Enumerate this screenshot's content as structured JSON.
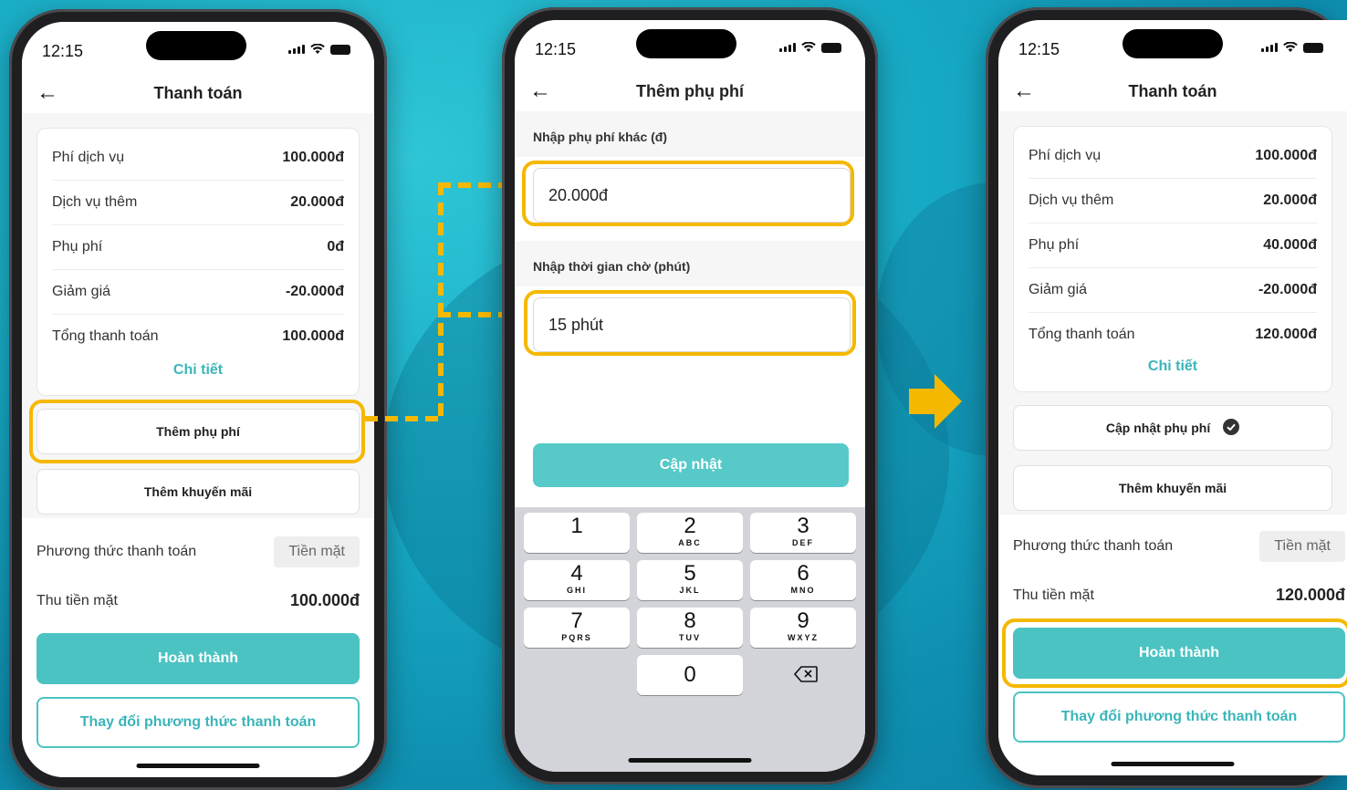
{
  "colors": {
    "accent": "#4bc3c2",
    "highlight": "#f5b800",
    "link": "#3ab5b9"
  },
  "status_time": "12:15",
  "screen1": {
    "title": "Thanh toán",
    "rows": [
      {
        "label": "Phí dịch vụ",
        "value": "100.000đ"
      },
      {
        "label": "Dịch vụ thêm",
        "value": "20.000đ"
      },
      {
        "label": "Phụ phí",
        "value": "0đ"
      },
      {
        "label": "Giảm giá",
        "value": "-20.000đ"
      },
      {
        "label": "Tổng thanh toán",
        "value": "100.000đ"
      }
    ],
    "detail_link": "Chi tiết",
    "surcharge_button": "Thêm phụ phí",
    "promo_button": "Thêm khuyến mãi",
    "payment_method_label": "Phương thức thanh toán",
    "payment_method_value": "Tiền mặt",
    "cash_label": "Thu tiền mặt",
    "cash_value": "100.000đ",
    "complete_button": "Hoàn thành",
    "change_method_button": "Thay đổi phương thức thanh toán"
  },
  "screen2": {
    "title": "Thêm phụ phí",
    "fee_label": "Nhập phụ phí khác (đ)",
    "fee_value": "20.000đ",
    "wait_label": "Nhập thời gian chờ (phút)",
    "wait_value": "15 phút",
    "update_button": "Cập nhật",
    "keys": [
      {
        "n": "1",
        "l": ""
      },
      {
        "n": "2",
        "l": "ABC"
      },
      {
        "n": "3",
        "l": "DEF"
      },
      {
        "n": "4",
        "l": "GHI"
      },
      {
        "n": "5",
        "l": "JKL"
      },
      {
        "n": "6",
        "l": "MNO"
      },
      {
        "n": "7",
        "l": "PQRS"
      },
      {
        "n": "8",
        "l": "TUV"
      },
      {
        "n": "9",
        "l": "WXYZ"
      },
      {
        "n": "0",
        "l": ""
      }
    ]
  },
  "screen3": {
    "title": "Thanh toán",
    "rows": [
      {
        "label": "Phí dịch vụ",
        "value": "100.000đ"
      },
      {
        "label": "Dịch vụ thêm",
        "value": "20.000đ"
      },
      {
        "label": "Phụ phí",
        "value": "40.000đ"
      },
      {
        "label": "Giảm giá",
        "value": "-20.000đ"
      },
      {
        "label": "Tổng thanh toán",
        "value": "120.000đ"
      }
    ],
    "detail_link": "Chi tiết",
    "surcharge_button": "Cập nhật phụ phí",
    "promo_button": "Thêm khuyến mãi",
    "payment_method_label": "Phương thức thanh toán",
    "payment_method_value": "Tiền mặt",
    "cash_label": "Thu tiền mặt",
    "cash_value": "120.000đ",
    "complete_button": "Hoàn thành",
    "change_method_button": "Thay đổi phương thức thanh toán"
  }
}
